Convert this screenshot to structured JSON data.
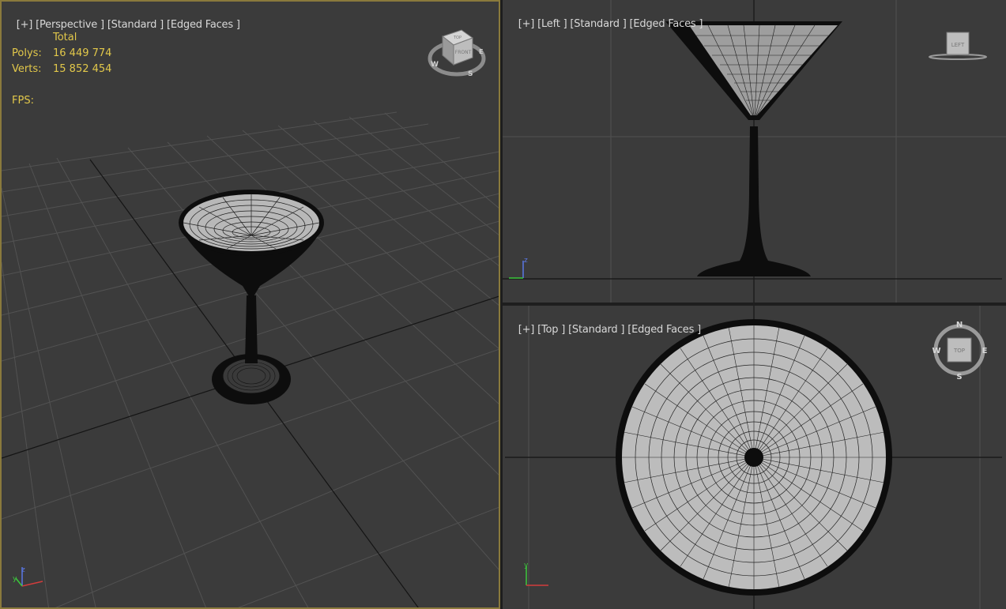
{
  "viewports": {
    "perspective": {
      "label": [
        "[+]",
        "[Perspective ]",
        "[Standard ]",
        "[Edged Faces ]"
      ],
      "active": true,
      "stats": {
        "header": "Total",
        "polys_label": "Polys:",
        "polys_value": "16 449 774",
        "verts_label": "Verts:",
        "verts_value": "15 852 454",
        "fps_label": "FPS:"
      },
      "viewcube": {
        "top_face": "TOP",
        "front_face": "FRONT",
        "compass": [
          "W",
          "S",
          "E"
        ]
      }
    },
    "left": {
      "label": [
        "[+]",
        "[Left ]",
        "[Standard ]",
        "[Edged Faces ]"
      ],
      "viewcube": {
        "face": "LEFT"
      }
    },
    "top": {
      "label": [
        "[+]",
        "[Top ]",
        "[Standard ]",
        "[Edged Faces ]"
      ],
      "viewcube": {
        "face": "TOP",
        "compass": [
          "N",
          "S",
          "W",
          "E"
        ]
      }
    }
  },
  "colors": {
    "background": "#3b3b3b",
    "grid": "#505050",
    "axis": "#111111",
    "active_border": "#8a7a3c",
    "stats_text": "#e2c84a",
    "label_text": "#d8d8d8",
    "axis_x": "#d23c3c",
    "axis_y": "#3cc83c",
    "axis_z": "#5a78e6"
  },
  "object": "martini-glass"
}
